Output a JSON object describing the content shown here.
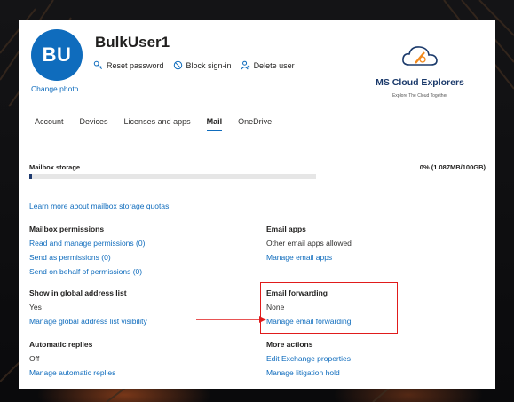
{
  "user": {
    "initials": "BU",
    "name": "BulkUser1",
    "change_photo": "Change photo"
  },
  "actions": [
    {
      "label": "Reset password",
      "icon": "key-icon"
    },
    {
      "label": "Block sign-in",
      "icon": "block-icon"
    },
    {
      "label": "Delete user",
      "icon": "person-delete-icon"
    }
  ],
  "brand": {
    "name": "MS Cloud Explorers",
    "tagline": "Explore The Cloud Together"
  },
  "tabs": [
    "Account",
    "Devices",
    "Licenses and apps",
    "Mail",
    "OneDrive"
  ],
  "active_tab": "Mail",
  "storage": {
    "label": "Mailbox storage",
    "value": "0% (1.087MB/100GB)",
    "percent": 0.01
  },
  "learn_more": "Learn more about mailbox storage quotas",
  "mailbox_permissions": {
    "title": "Mailbox permissions",
    "links": [
      "Read and manage permissions (0)",
      "Send as permissions (0)",
      "Send on behalf of permissions (0)"
    ]
  },
  "email_apps": {
    "title": "Email apps",
    "text": "Other email apps allowed",
    "link": "Manage email apps"
  },
  "global_address": {
    "title": "Show in global address list",
    "text": "Yes",
    "link": "Manage global address list visibility"
  },
  "email_forwarding": {
    "title": "Email forwarding",
    "text": "None",
    "link": "Manage email forwarding"
  },
  "auto_replies": {
    "title": "Automatic replies",
    "text": "Off",
    "link": "Manage automatic replies"
  },
  "more_actions": {
    "title": "More actions",
    "links": [
      "Edit Exchange properties",
      "Manage litigation hold"
    ]
  },
  "colors": {
    "accent": "#0f6cbd",
    "highlight": "#e01b1b",
    "storage_fill": "#1f3b70"
  }
}
